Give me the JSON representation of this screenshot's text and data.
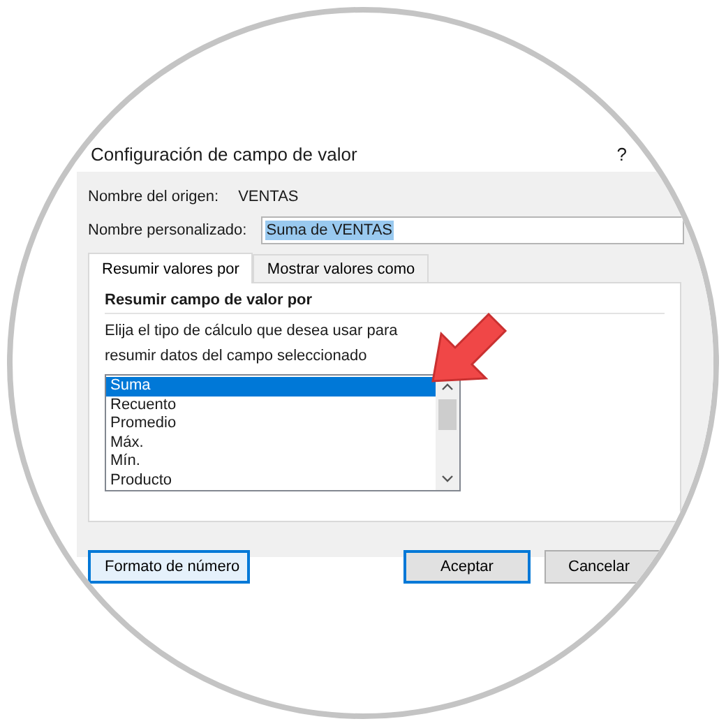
{
  "dialog": {
    "title": "Configuración de campo de valor",
    "help": "?"
  },
  "source_name": {
    "label": "Nombre del origen:",
    "value": "VENTAS"
  },
  "custom_name": {
    "label": "Nombre personalizado:",
    "value": "Suma de VENTAS",
    "text_selected": true
  },
  "tabs": [
    {
      "label": "Resumir valores por",
      "selected": true
    },
    {
      "label": "Mostrar valores como",
      "selected": false
    }
  ],
  "panel": {
    "heading": "Resumir campo de valor por",
    "description": "Elija el tipo de cálculo que desea usar para resumir datos del campo seleccionado"
  },
  "functions": [
    {
      "label": "Suma",
      "selected": true
    },
    {
      "label": "Recuento",
      "selected": false
    },
    {
      "label": "Promedio",
      "selected": false
    },
    {
      "label": "Máx.",
      "selected": false
    },
    {
      "label": "Mín.",
      "selected": false
    },
    {
      "label": "Producto",
      "selected": false
    }
  ],
  "buttons": [
    {
      "label": "Formato de número",
      "kind": "focused"
    },
    {
      "label": "Aceptar",
      "kind": "default"
    },
    {
      "label": "Cancelar",
      "kind": "normal"
    }
  ]
}
